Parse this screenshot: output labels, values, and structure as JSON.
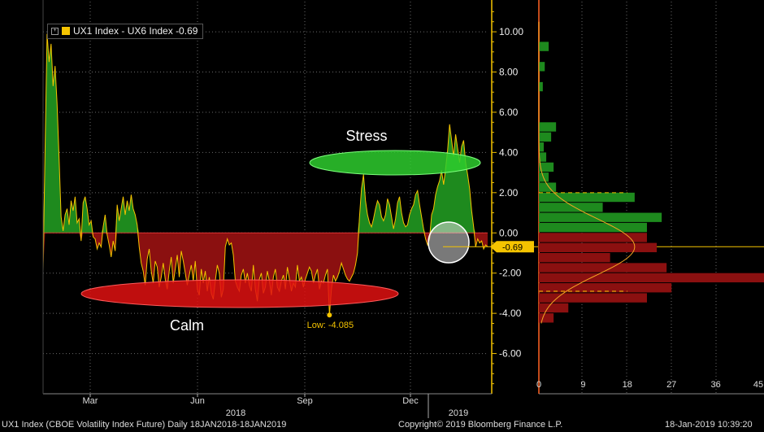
{
  "legend": {
    "label": "UX1 Index - UX6 Index -0.69",
    "color": "#f5c400"
  },
  "footer": {
    "left": "UX1 Index (CBOE Volatility Index Future)  Daily 18JAN2018-18JAN2019",
    "center": "Copyright© 2019 Bloomberg Finance L.P.",
    "right": "18-Jan-2019 10:39:20"
  },
  "colors": {
    "positive": "#1e8a1e",
    "negative": "#8b1010",
    "line": "#f5c400",
    "grid": "#6a6a6a",
    "fit": "#f5a623"
  },
  "chart_data": {
    "type": "area",
    "x_months": [
      "Mar",
      "Jun",
      "Sep",
      "Dec"
    ],
    "x_years": [
      "2018",
      "2019"
    ],
    "ylim": [
      -8,
      11.5
    ],
    "yticks": [
      "10.00",
      "8.00",
      "6.00",
      "4.00",
      "2.00",
      "0.00",
      "-2.00",
      "-4.00",
      "-6.00"
    ],
    "series": [
      {
        "values": [
          -1.9,
          4.2,
          9.9,
          8.5,
          9.4,
          7.3,
          8.3,
          6.4,
          3.7,
          0.8,
          0.1,
          0.9,
          1.2,
          0.4,
          1.6,
          1.1,
          1.8,
          0.5,
          0.7,
          -0.4,
          1.5,
          1.8,
          1.2,
          0.4,
          0.6,
          -0.2,
          -0.3,
          -0.8,
          -0.5,
          -0.7,
          0.3,
          0.9,
          -0.1,
          -0.6,
          -1.2,
          -0.4,
          -0.9,
          1.4,
          0.6,
          1.2,
          1.8,
          0.9,
          1.6,
          1.1,
          1.9,
          1.2,
          0.9,
          0.4,
          -0.7,
          -1.5,
          -1.9,
          -2.6,
          -1.3,
          -0.8,
          -1.9,
          -2.5,
          -1.4,
          -1.7,
          -2.7,
          -2.2,
          -1.5,
          -2.3,
          -2.8,
          -1.9,
          -1.2,
          -2.5,
          -1.8,
          -1.1,
          -2.2,
          -0.9,
          -1.4,
          -2.0,
          -2.6,
          -2.1,
          -1.6,
          -2.4,
          -1.4,
          -2.8,
          -3.1,
          -1.8,
          -2.5,
          -1.9,
          -2.9,
          -2.2,
          -3.0,
          -3.3,
          -2.4,
          -1.6,
          -2.0,
          -3.2,
          -2.8,
          -0.7,
          -0.3,
          -0.6,
          -0.5,
          -1.1,
          -2.4,
          -2.7,
          -2.9,
          -2.1,
          -1.8,
          -2.5,
          -2.0,
          -2.6,
          -2.9,
          -1.6,
          -2.8,
          -3.4,
          -2.3,
          -2.0,
          -3.0,
          -2.7,
          -1.9,
          -2.4,
          -3.1,
          -2.2,
          -1.8,
          -2.7,
          -2.9,
          -2.4,
          -2.1,
          -2.8,
          -1.7,
          -2.3,
          -2.9,
          -2.5,
          -2.7,
          -1.6,
          -2.4,
          -2.2,
          -2.7,
          -2.3,
          -2.0,
          -1.7,
          -1.9,
          -2.5,
          -2.1,
          -1.8,
          -2.8,
          -2.4,
          -2.5,
          -2.1,
          -1.8,
          -4.085,
          -2.8,
          -2.1,
          -2.4,
          -2.2,
          -1.9,
          -1.5,
          -1.8,
          -2.1,
          -2.3,
          -2.4,
          -2.2,
          -2.0,
          -1.6,
          -1.0,
          0.8,
          2.2,
          2.9,
          1.6,
          0.9,
          0.5,
          0.3,
          0.7,
          1.2,
          1.6,
          1.4,
          0.8,
          0.6,
          0.9,
          1.7,
          1.4,
          0.8,
          0.2,
          0.7,
          1.5,
          1.8,
          1.0,
          0.5,
          0.3,
          0.4,
          0.9,
          1.2,
          1.4,
          1.9,
          2.1,
          1.4,
          0.8,
          0.2,
          -0.3,
          -0.6,
          -0.3,
          0.9,
          1.2,
          1.9,
          2.3,
          2.6,
          3.1,
          2.4,
          3.2,
          4.1,
          5.4,
          4.6,
          3.8,
          4.9,
          4.2,
          3.5,
          4.3,
          4.6,
          3.5,
          2.9,
          2.2,
          1.1,
          0.3,
          -0.7,
          -0.3,
          -0.5,
          -0.4,
          -0.8,
          -0.6,
          -0.69
        ]
      }
    ],
    "annotations": {
      "stress": "Stress",
      "calm": "Calm",
      "low": "Low: -4.085",
      "last": "-0.69"
    },
    "histogram": {
      "bins_pos": [
        {
          "from": 9,
          "to": 9.5,
          "count": 2
        },
        {
          "from": 8,
          "to": 8.5,
          "count": 1.2
        },
        {
          "from": 7,
          "to": 7.5,
          "count": 0.8
        },
        {
          "from": 5,
          "to": 5.5,
          "count": 3.5
        },
        {
          "from": 4.5,
          "to": 5,
          "count": 2.5
        },
        {
          "from": 4,
          "to": 4.5,
          "count": 1
        },
        {
          "from": 3.5,
          "to": 4,
          "count": 1.5
        },
        {
          "from": 3,
          "to": 3.5,
          "count": 3
        },
        {
          "from": 2.5,
          "to": 3,
          "count": 2
        },
        {
          "from": 2,
          "to": 2.5,
          "count": 3.5
        },
        {
          "from": 1.5,
          "to": 2,
          "count": 19.5
        },
        {
          "from": 1,
          "to": 1.5,
          "count": 13
        },
        {
          "from": 0.5,
          "to": 1,
          "count": 25
        },
        {
          "from": 0,
          "to": 0.5,
          "count": 22
        }
      ],
      "bins_neg": [
        {
          "from": -0.5,
          "to": 0,
          "count": 22
        },
        {
          "from": -1,
          "to": -0.5,
          "count": 24
        },
        {
          "from": -1.5,
          "to": -1,
          "count": 14.5
        },
        {
          "from": -2,
          "to": -1.5,
          "count": 26
        },
        {
          "from": -2.5,
          "to": -2,
          "count": 54
        },
        {
          "from": -3,
          "to": -2.5,
          "count": 27
        },
        {
          "from": -3.5,
          "to": -3,
          "count": 22
        },
        {
          "from": -4,
          "to": -3.5,
          "count": 6
        },
        {
          "from": -4.5,
          "to": -4,
          "count": 3
        }
      ],
      "xticks": [
        "0",
        "9",
        "18",
        "27",
        "36",
        "45"
      ],
      "xlim": [
        0,
        45
      ],
      "dashed_levels": [
        2,
        -2.9
      ]
    }
  }
}
